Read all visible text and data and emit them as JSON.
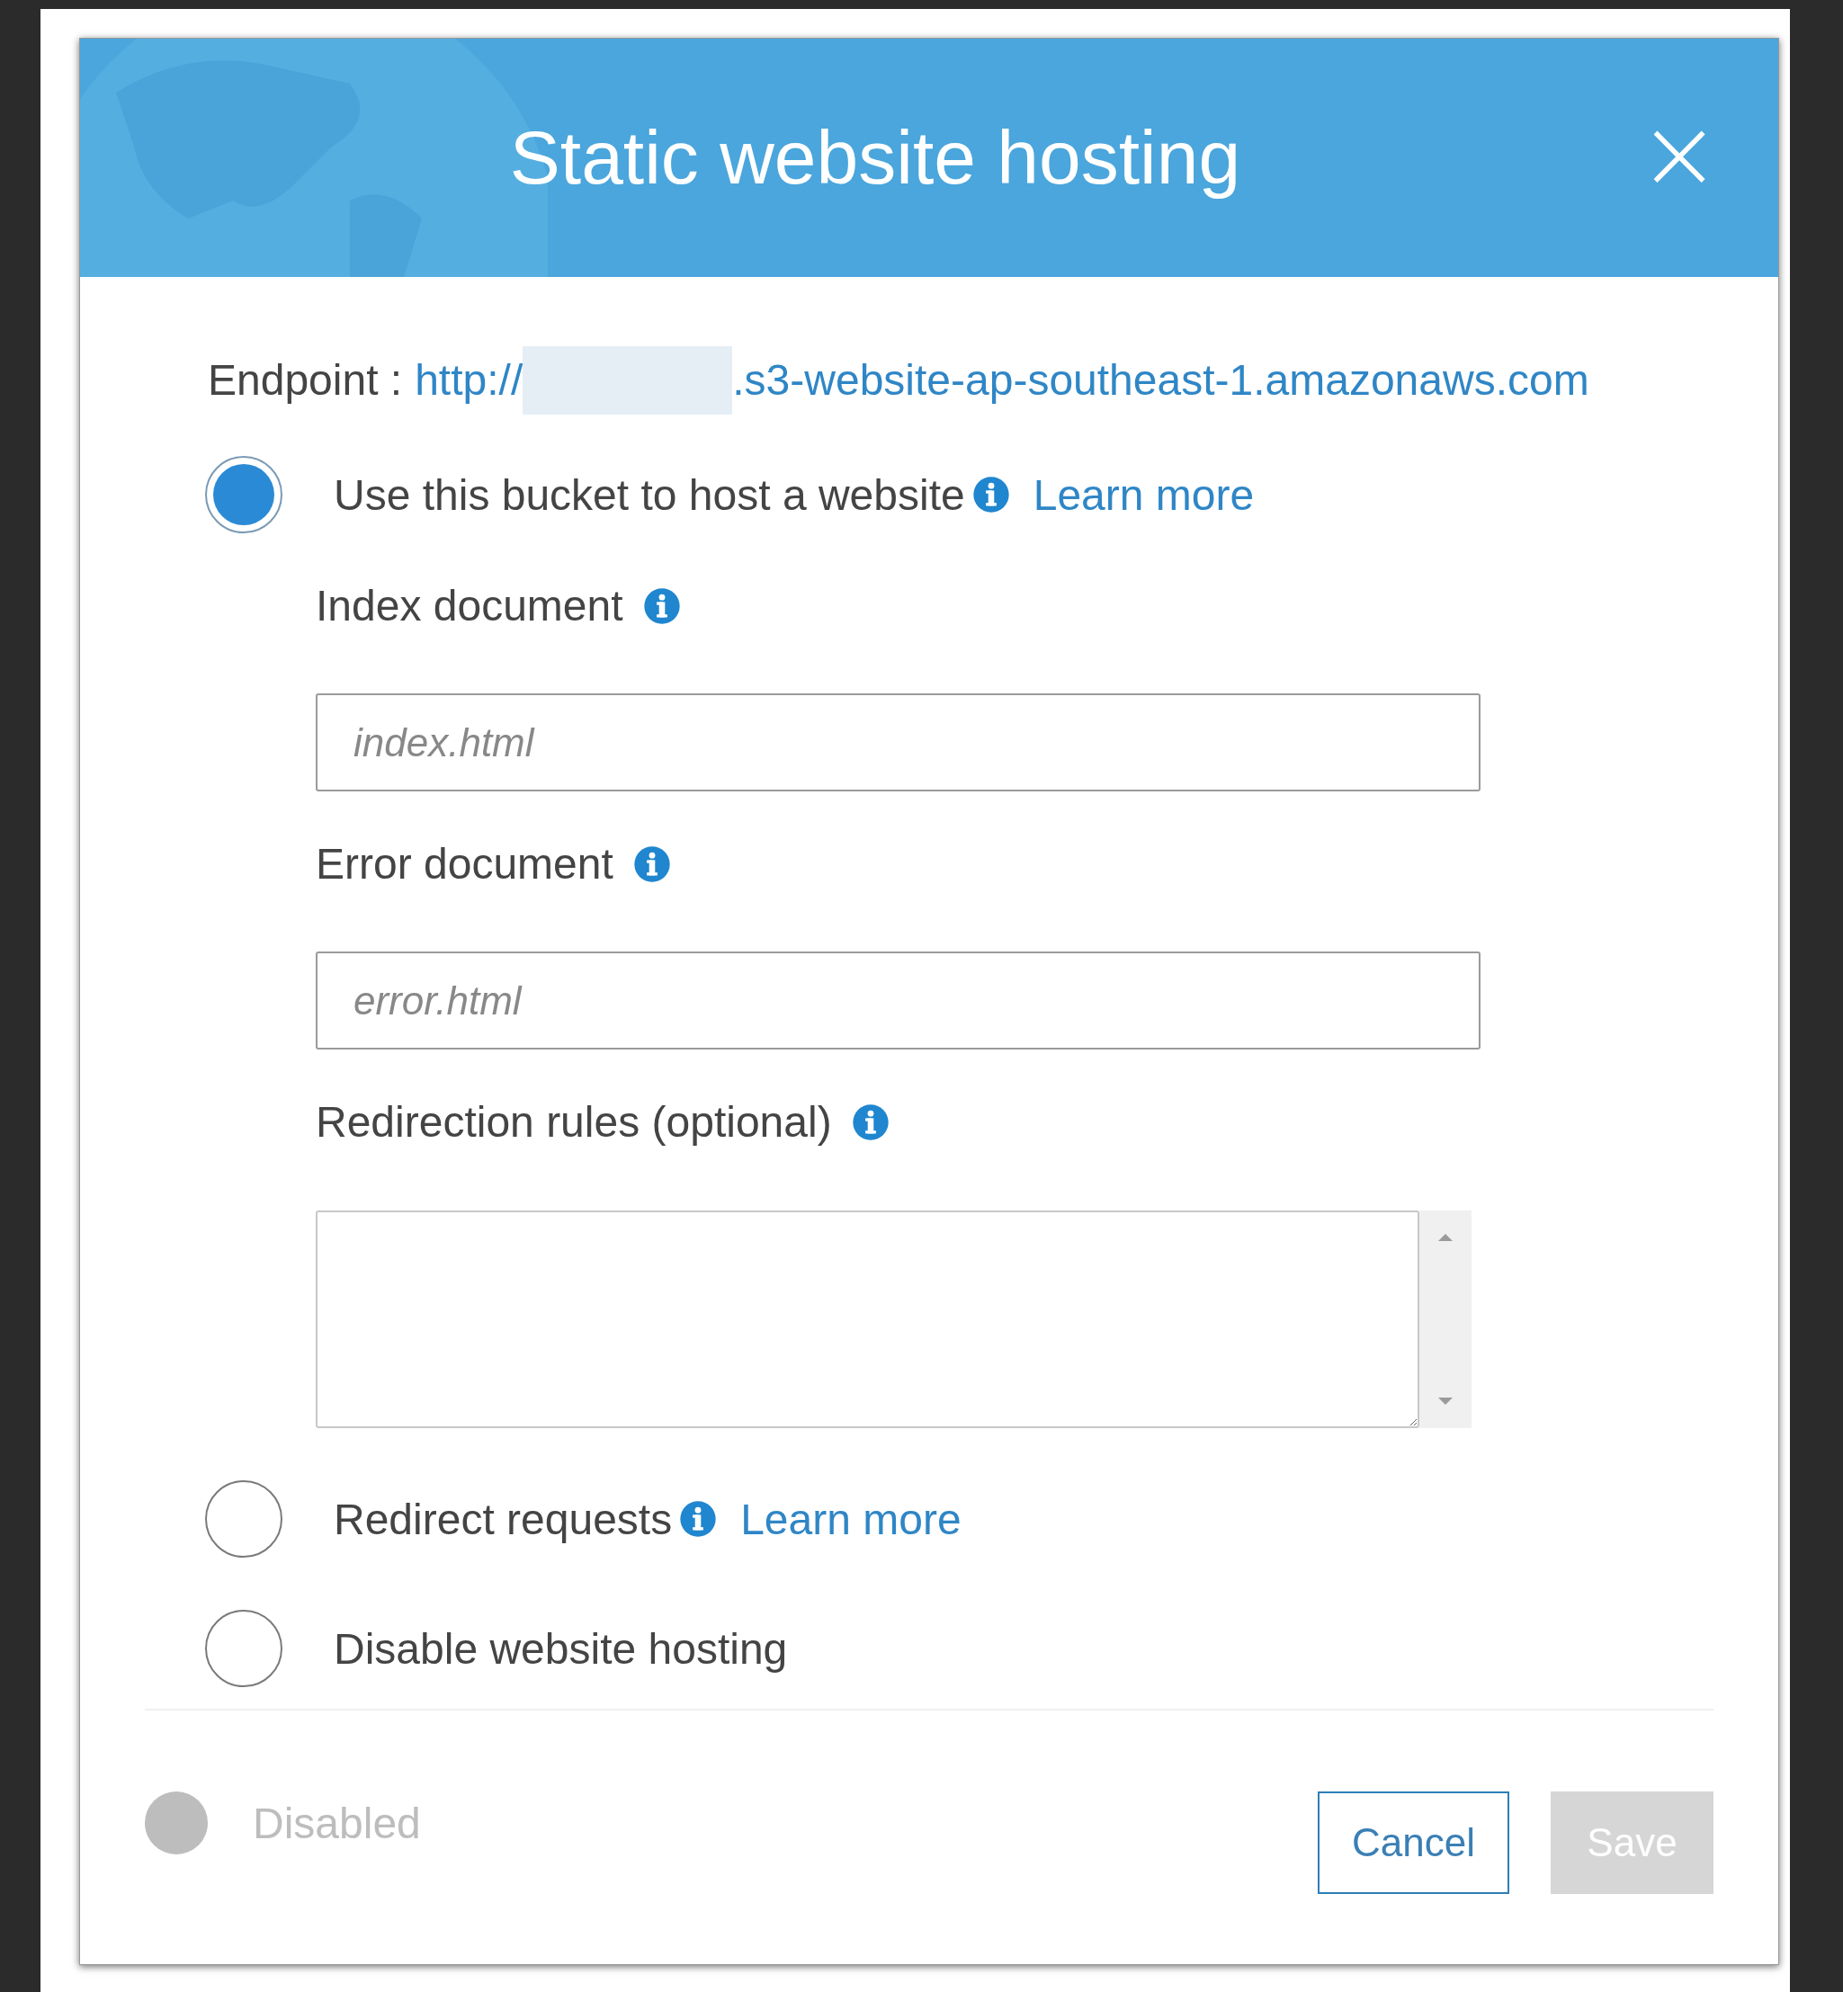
{
  "dialog": {
    "title": "Static website hosting",
    "close": "×"
  },
  "endpoint": {
    "label": "Endpoint :",
    "url_start": "http://",
    "url_end": ".s3-website-ap-southeast-1.amazonaws.com"
  },
  "options": [
    {
      "label": "Use this bucket to host a website",
      "selected": true,
      "info": true,
      "link": "Learn more",
      "fields": [
        {
          "kind": "input",
          "label": "Index document",
          "placeholder": "index.html"
        },
        {
          "kind": "input",
          "label": "Error document",
          "placeholder": "error.html"
        },
        {
          "kind": "textarea",
          "label": "Redirection rules (optional)"
        }
      ]
    },
    {
      "label": "Redirect requests",
      "selected": false,
      "info": true,
      "link": "Learn more"
    },
    {
      "label": "Disable website hosting",
      "selected": false,
      "info": false
    }
  ],
  "footer": {
    "status": "Disabled",
    "status_on": false,
    "buttons": [
      {
        "label": "Cancel",
        "disabled": false
      },
      {
        "label": "Save",
        "disabled": true
      }
    ]
  }
}
